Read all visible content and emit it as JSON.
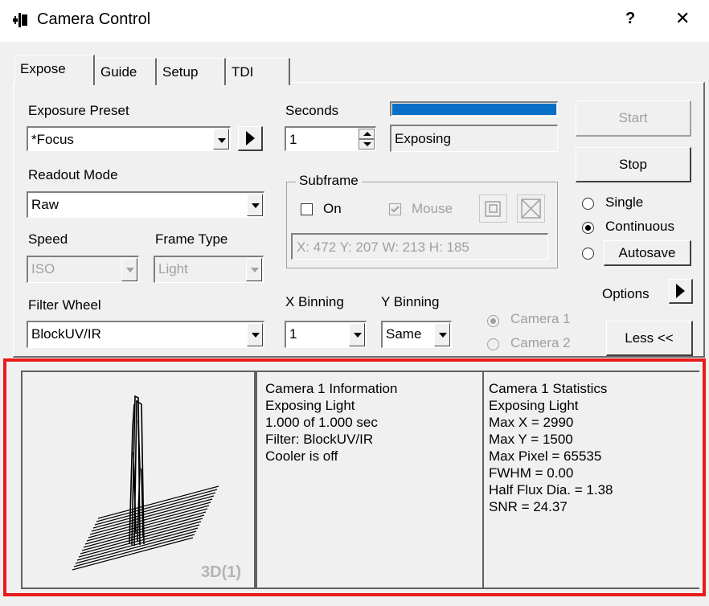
{
  "window": {
    "title": "Camera Control",
    "help_label": "?",
    "close_label": "✕"
  },
  "tabs": [
    "Expose",
    "Guide",
    "Setup",
    "TDI"
  ],
  "expose": {
    "preset_label": "Exposure Preset",
    "preset_value": "*Focus",
    "seconds_label": "Seconds",
    "seconds_value": "1",
    "progress": 1.0,
    "status": "Exposing",
    "start_label": "Start",
    "stop_label": "Stop",
    "readout_label": "Readout Mode",
    "readout_value": "Raw",
    "subframe": {
      "title": "Subframe",
      "on_label": "On",
      "mouse_label": "Mouse",
      "coords": "X: 472 Y: 207 W: 213 H: 185"
    },
    "mode": {
      "single": "Single",
      "continuous": "Continuous",
      "autosave": "Autosave",
      "selected": "Continuous"
    },
    "speed_label": "Speed",
    "speed_value": "ISO",
    "frame_type_label": "Frame Type",
    "frame_type_value": "Light",
    "options_label": "Options",
    "filter_wheel_label": "Filter Wheel",
    "filter_value": "BlockUV/IR",
    "x_binning_label": "X Binning",
    "x_binning_value": "1",
    "y_binning_label": "Y Binning",
    "y_binning_value": "Same",
    "camera1": "Camera 1",
    "camera2": "Camera 2",
    "less_label": "Less <<"
  },
  "preview": {
    "label": "3D(1)"
  },
  "info": {
    "lines": [
      "Camera 1 Information",
      "Exposing Light",
      "1.000 of 1.000 sec",
      "Filter: BlockUV/IR",
      "Cooler is off"
    ]
  },
  "stats": {
    "lines": [
      "Camera 1 Statistics",
      "Exposing Light",
      "Max X = 2990",
      "Max Y = 1500",
      "Max Pixel = 65535",
      "FWHM = 0.00",
      "Half Flux Dia. = 1.38",
      "SNR = 24.37"
    ]
  },
  "colors": {
    "progress": "#0a6fc7",
    "highlight": "#e81a1a"
  }
}
